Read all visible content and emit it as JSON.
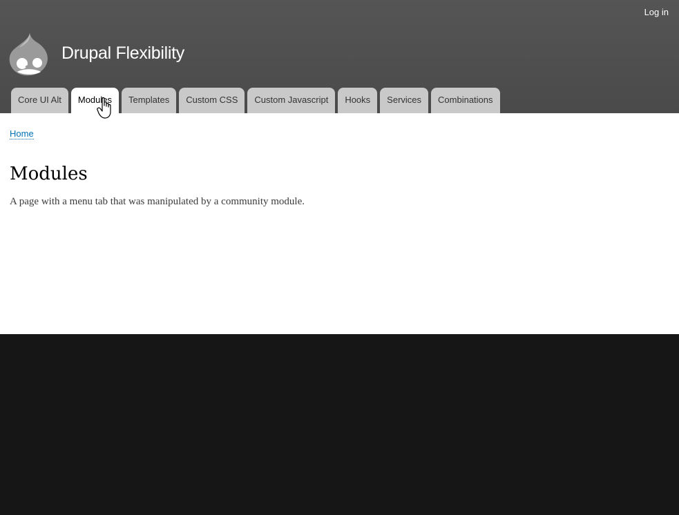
{
  "header": {
    "login_label": "Log in",
    "site_name": "Drupal Flexibility",
    "logo_icon": "drupal-drop-icon"
  },
  "tabs": [
    {
      "label": "Core UI Alt",
      "active": false
    },
    {
      "label": "Modules",
      "active": true
    },
    {
      "label": "Templates",
      "active": false
    },
    {
      "label": "Custom CSS",
      "active": false
    },
    {
      "label": "Custom Javascript",
      "active": false
    },
    {
      "label": "Hooks",
      "active": false
    },
    {
      "label": "Services",
      "active": false
    },
    {
      "label": "Combinations",
      "active": false
    }
  ],
  "main": {
    "breadcrumb": "Home",
    "title": "Modules",
    "body": "A page with a menu tab that was manipulated by a community module."
  },
  "colors": {
    "header_bg": "#4f4f4f",
    "tab_bg": "#c9c9c9",
    "active_tab_bg": "#ffffff",
    "link": "#0071b3",
    "footer_bg": "#161616"
  },
  "cursor_icon": "hand-pointer-icon"
}
